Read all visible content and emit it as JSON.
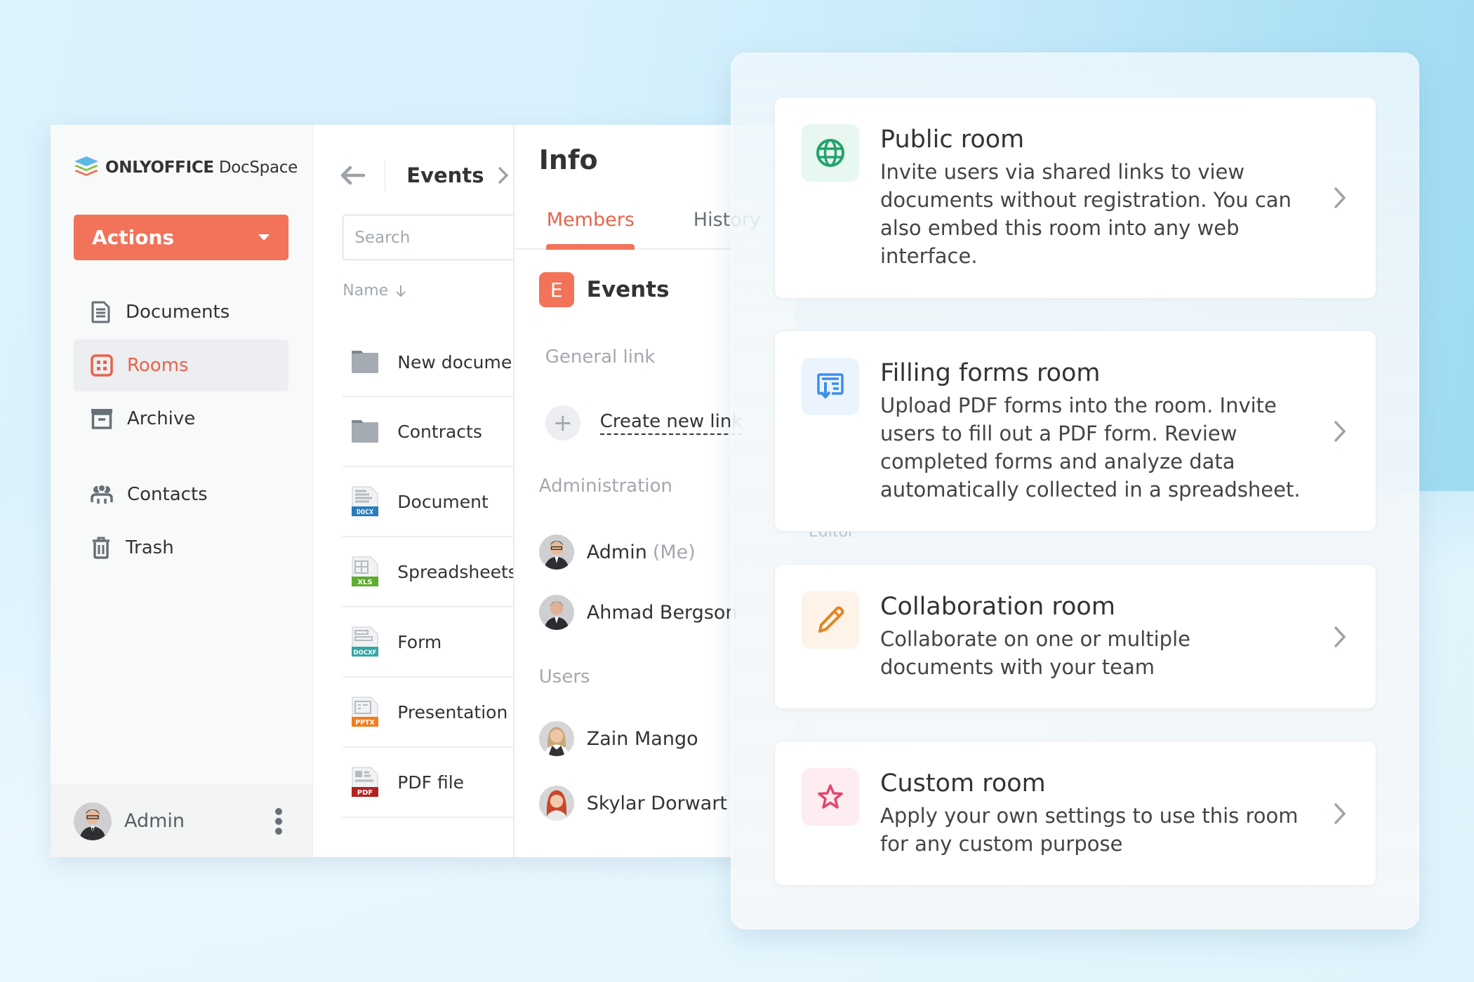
{
  "app": {
    "brand_bold": "ONLYOFFICE",
    "brand_light": "DocSpace",
    "actions_label": "Actions",
    "nav": [
      {
        "label": "Documents",
        "icon": "document-icon",
        "active": false
      },
      {
        "label": "Rooms",
        "icon": "rooms-icon",
        "active": true
      },
      {
        "label": "Archive",
        "icon": "archive-icon",
        "active": false
      },
      {
        "label": "Contacts",
        "icon": "contacts-icon",
        "active": false
      },
      {
        "label": "Trash",
        "icon": "trash-icon",
        "active": false
      }
    ],
    "user": {
      "name": "Admin"
    },
    "accent_color": "#f2735a"
  },
  "files": {
    "room_title": "Events",
    "search_placeholder": "Search",
    "sort_label": "Name",
    "items": [
      {
        "name": "New documents",
        "type": "folder"
      },
      {
        "name": "Contracts",
        "type": "folder"
      },
      {
        "name": "Document",
        "type": "docx",
        "badge": "DOCX",
        "color": "#2a7cbd"
      },
      {
        "name": "Spreadsheets",
        "type": "xls",
        "badge": "XLS",
        "color": "#5cae2c"
      },
      {
        "name": "Form",
        "type": "docxf",
        "badge": "DOCXF",
        "color": "#36a6a4"
      },
      {
        "name": "Presentation",
        "type": "pptx",
        "badge": "PPTX",
        "color": "#f07d1c"
      },
      {
        "name": "PDF file",
        "type": "pdf",
        "badge": "PDF",
        "color": "#b4211f"
      }
    ]
  },
  "info": {
    "title": "Info",
    "tabs": [
      "Members",
      "History"
    ],
    "room_initial": "E",
    "room_name": "Events",
    "general_link_label": "General link",
    "create_link_label": "Create new link",
    "administration_label": "Administration",
    "admins": [
      {
        "name": "Admin",
        "suffix": "(Me)"
      },
      {
        "name": "Ahmad Bergson",
        "suffix": ""
      }
    ],
    "users_label": "Users",
    "users": [
      {
        "name": "Zain Mango"
      },
      {
        "name": "Skylar Dorwart"
      }
    ]
  },
  "panel": {
    "ghost_label": "Editor",
    "rooms": [
      {
        "title": "Public room",
        "description": "Invite users via shared links to view documents without registration. You can also embed this room into any web interface.",
        "icon": "globe-icon",
        "icon_color": "#22a36b",
        "icon_bg": "#e8f7f0"
      },
      {
        "title": "Filling forms room",
        "description": "Upload PDF forms into the room. Invite users to fill out a PDF form. Review completed forms and analyze data automatically collected in a spreadsheet.",
        "icon": "form-fill-icon",
        "icon_color": "#3b8ee8",
        "icon_bg": "#ebf4fd"
      },
      {
        "title": "Collaboration room",
        "description": "Collaborate on one or multiple documents with your team",
        "icon": "pencil-icon",
        "icon_color": "#e38521",
        "icon_bg": "#fdf3e8"
      },
      {
        "title": "Custom room",
        "description": "Apply your own settings to use this room for any custom purpose",
        "icon": "star-icon",
        "icon_color": "#e2466f",
        "icon_bg": "#fdecf0"
      }
    ]
  }
}
